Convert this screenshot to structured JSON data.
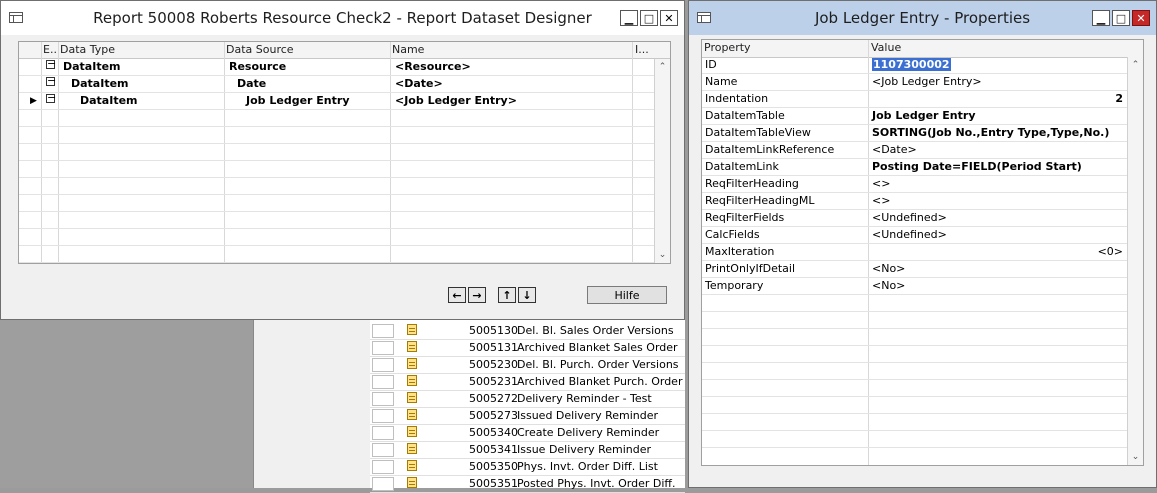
{
  "background_list": {
    "rows": [
      {
        "id": "5005130",
        "name": "Del. Bl. Sales Order Versions"
      },
      {
        "id": "5005131",
        "name": "Archived Blanket Sales Order"
      },
      {
        "id": "5005230",
        "name": "Del. Bl. Purch. Order Versions"
      },
      {
        "id": "5005231",
        "name": "Archived Blanket Purch. Order"
      },
      {
        "id": "5005272",
        "name": "Delivery Reminder - Test"
      },
      {
        "id": "5005273",
        "name": "Issued Delivery Reminder"
      },
      {
        "id": "5005340",
        "name": "Create Delivery Reminder"
      },
      {
        "id": "5005341",
        "name": "Issue Delivery Reminder"
      },
      {
        "id": "5005350",
        "name": "Phys. Invt. Order Diff. List"
      },
      {
        "id": "5005351",
        "name": "Posted Phys. Invt. Order Diff."
      }
    ]
  },
  "designer": {
    "title": "Report 50008 Roberts Resource Check2 - Report Dataset Designer",
    "columns": {
      "e": "E..",
      "data_type": "Data Type",
      "data_source": "Data Source",
      "name": "Name",
      "i": "I..."
    },
    "rows": [
      {
        "data_type": "DataItem",
        "data_source": "Resource",
        "name": "<Resource>"
      },
      {
        "data_type": "DataItem",
        "data_source": "Date",
        "name": "<Date>"
      },
      {
        "data_type": "DataItem",
        "data_source": "Job Ledger Entry",
        "name": "<Job Ledger Entry>"
      }
    ],
    "help_label": "Hilfe",
    "nav": {
      "left": "←",
      "right": "→",
      "up": "↑",
      "down": "↓"
    }
  },
  "properties": {
    "title": "Job Ledger Entry - Properties",
    "columns": {
      "property": "Property",
      "value": "Value"
    },
    "rows": [
      {
        "property": "ID",
        "value": "1107300002",
        "align": "left",
        "bold": true,
        "selected": true
      },
      {
        "property": "Name",
        "value": "<Job Ledger Entry>",
        "align": "left",
        "bold": false
      },
      {
        "property": "Indentation",
        "value": "2",
        "align": "right",
        "bold": true
      },
      {
        "property": "DataItemTable",
        "value": "Job Ledger Entry",
        "align": "left",
        "bold": true
      },
      {
        "property": "DataItemTableView",
        "value": "SORTING(Job No.,Entry Type,Type,No.)",
        "align": "left",
        "bold": true
      },
      {
        "property": "DataItemLinkReference",
        "value": "<Date>",
        "align": "left",
        "bold": false
      },
      {
        "property": "DataItemLink",
        "value": "Posting Date=FIELD(Period Start)",
        "align": "left",
        "bold": true
      },
      {
        "property": "ReqFilterHeading",
        "value": "<>",
        "align": "left",
        "bold": false
      },
      {
        "property": "ReqFilterHeadingML",
        "value": "<>",
        "align": "left",
        "bold": false
      },
      {
        "property": "ReqFilterFields",
        "value": "<Undefined>",
        "align": "left",
        "bold": false
      },
      {
        "property": "CalcFields",
        "value": "<Undefined>",
        "align": "left",
        "bold": false
      },
      {
        "property": "MaxIteration",
        "value": "<0>",
        "align": "right",
        "bold": false
      },
      {
        "property": "PrintOnlyIfDetail",
        "value": "<No>",
        "align": "left",
        "bold": false
      },
      {
        "property": "Temporary",
        "value": "<No>",
        "align": "left",
        "bold": false
      }
    ]
  },
  "title_buttons": {
    "minimize": "▁",
    "maximize": "□",
    "close": "✕"
  },
  "icons": {
    "scroll_up": "chevron-up-icon",
    "scroll_down": "chevron-down-icon",
    "row_pointer": "triangle-right-icon"
  }
}
